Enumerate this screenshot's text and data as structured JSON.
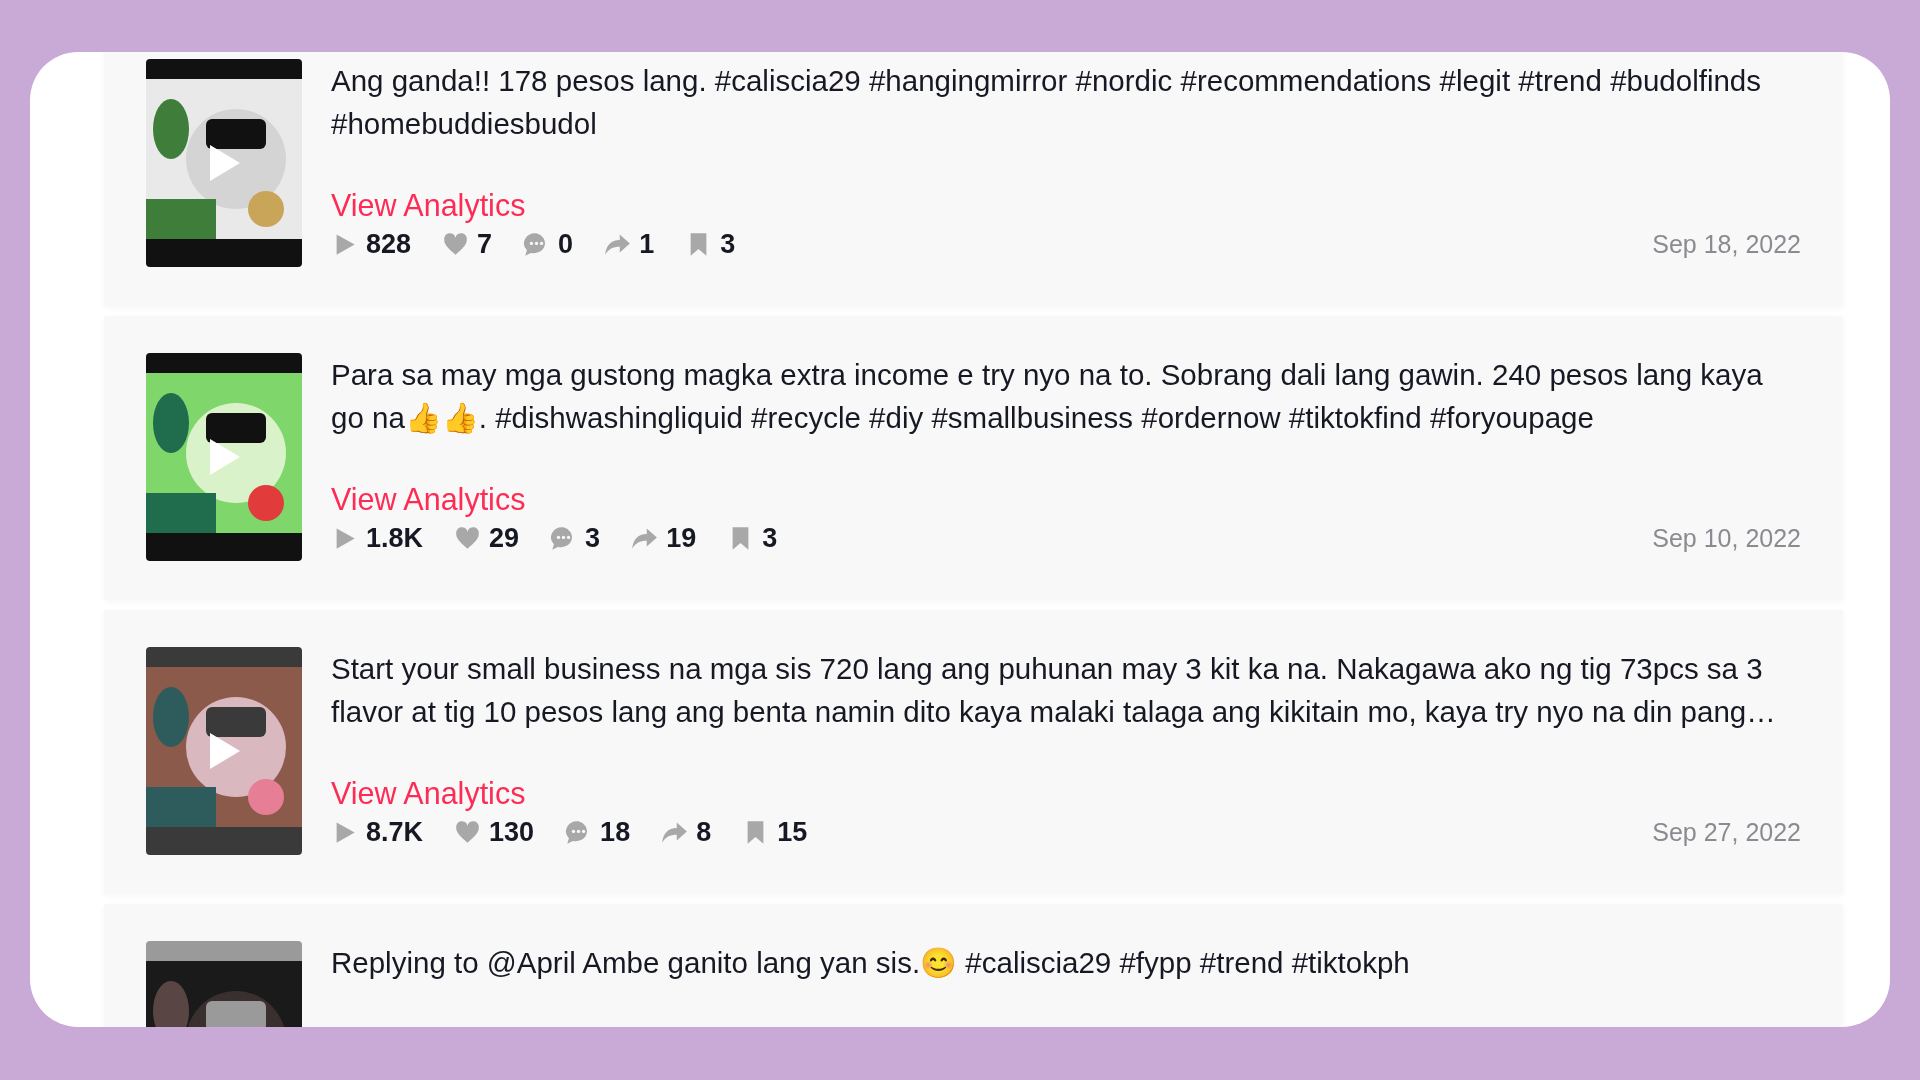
{
  "posts": [
    {
      "thumbnail": {
        "kind": "picture",
        "play_overlay": true
      },
      "description": "Ang ganda!! 178 pesos lang. #caliscia29 #hangingmirror #nordic #recommendations #legit #trend #budolfinds #homebuddiesbudol",
      "link": "View Analytics",
      "stats": [
        {
          "kind": "views",
          "value": "828"
        },
        {
          "kind": "likes",
          "value": "7"
        },
        {
          "kind": "comments",
          "value": "0"
        },
        {
          "kind": "shares",
          "value": "1"
        },
        {
          "kind": "saves",
          "value": "3"
        }
      ],
      "date": "Sep 18, 2022"
    },
    {
      "thumbnail": {
        "kind": "picture",
        "play_overlay": true
      },
      "description": "Para sa may mga gustong magka extra income e try nyo na to. Sobrang dali lang gawin. 240 pesos lang kaya go na👍👍. #dishwashingliquid #recycle #diy #smallbusiness #ordernow #tiktokfind #foryoupage",
      "link": "View Analytics",
      "stats": [
        {
          "kind": "views",
          "value": "1.8K"
        },
        {
          "kind": "likes",
          "value": "29"
        },
        {
          "kind": "comments",
          "value": "3"
        },
        {
          "kind": "shares",
          "value": "19"
        },
        {
          "kind": "saves",
          "value": "3"
        }
      ],
      "date": "Sep 10, 2022"
    },
    {
      "thumbnail": {
        "kind": "picture",
        "play_overlay": true
      },
      "description": "Start your small business na mga sis 720 lang ang puhunan may 3 kit ka na. Nakagawa ako ng tig 73pcs sa 3 flavor at tig 10 pesos lang ang benta namin dito kaya malaki talaga ang kikitain mo, kaya try nyo na din pang…",
      "link": "View Analytics",
      "stats": [
        {
          "kind": "views",
          "value": "8.7K"
        },
        {
          "kind": "likes",
          "value": "130"
        },
        {
          "kind": "comments",
          "value": "18"
        },
        {
          "kind": "shares",
          "value": "8"
        },
        {
          "kind": "saves",
          "value": "15"
        }
      ],
      "date": "Sep 27, 2022"
    },
    {
      "thumbnail": {
        "kind": "picture",
        "play_overlay": false
      },
      "description": "Replying to @April Ambe ganito lang yan sis.😊 #caliscia29 #fypp #trend #tiktokph"
    }
  ]
}
